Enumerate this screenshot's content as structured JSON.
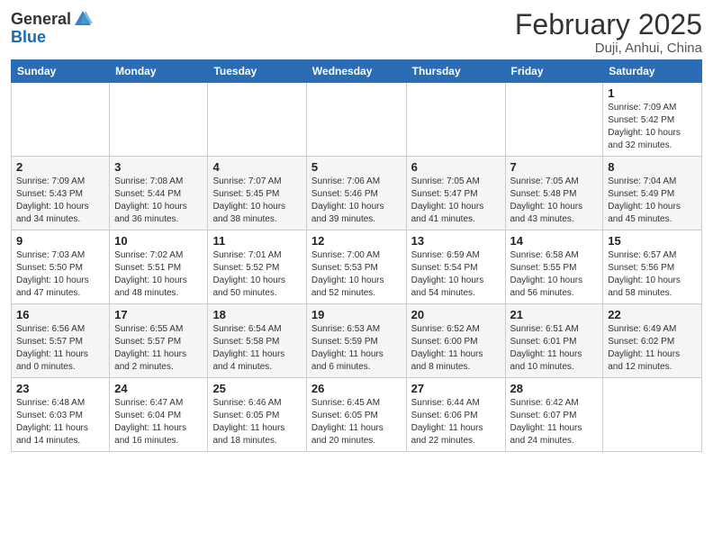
{
  "logo": {
    "general": "General",
    "blue": "Blue"
  },
  "title": "February 2025",
  "location": "Duji, Anhui, China",
  "days_of_week": [
    "Sunday",
    "Monday",
    "Tuesday",
    "Wednesday",
    "Thursday",
    "Friday",
    "Saturday"
  ],
  "weeks": [
    [
      {
        "day": "",
        "info": ""
      },
      {
        "day": "",
        "info": ""
      },
      {
        "day": "",
        "info": ""
      },
      {
        "day": "",
        "info": ""
      },
      {
        "day": "",
        "info": ""
      },
      {
        "day": "",
        "info": ""
      },
      {
        "day": "1",
        "info": "Sunrise: 7:09 AM\nSunset: 5:42 PM\nDaylight: 10 hours\nand 32 minutes."
      }
    ],
    [
      {
        "day": "2",
        "info": "Sunrise: 7:09 AM\nSunset: 5:43 PM\nDaylight: 10 hours\nand 34 minutes."
      },
      {
        "day": "3",
        "info": "Sunrise: 7:08 AM\nSunset: 5:44 PM\nDaylight: 10 hours\nand 36 minutes."
      },
      {
        "day": "4",
        "info": "Sunrise: 7:07 AM\nSunset: 5:45 PM\nDaylight: 10 hours\nand 38 minutes."
      },
      {
        "day": "5",
        "info": "Sunrise: 7:06 AM\nSunset: 5:46 PM\nDaylight: 10 hours\nand 39 minutes."
      },
      {
        "day": "6",
        "info": "Sunrise: 7:05 AM\nSunset: 5:47 PM\nDaylight: 10 hours\nand 41 minutes."
      },
      {
        "day": "7",
        "info": "Sunrise: 7:05 AM\nSunset: 5:48 PM\nDaylight: 10 hours\nand 43 minutes."
      },
      {
        "day": "8",
        "info": "Sunrise: 7:04 AM\nSunset: 5:49 PM\nDaylight: 10 hours\nand 45 minutes."
      }
    ],
    [
      {
        "day": "9",
        "info": "Sunrise: 7:03 AM\nSunset: 5:50 PM\nDaylight: 10 hours\nand 47 minutes."
      },
      {
        "day": "10",
        "info": "Sunrise: 7:02 AM\nSunset: 5:51 PM\nDaylight: 10 hours\nand 48 minutes."
      },
      {
        "day": "11",
        "info": "Sunrise: 7:01 AM\nSunset: 5:52 PM\nDaylight: 10 hours\nand 50 minutes."
      },
      {
        "day": "12",
        "info": "Sunrise: 7:00 AM\nSunset: 5:53 PM\nDaylight: 10 hours\nand 52 minutes."
      },
      {
        "day": "13",
        "info": "Sunrise: 6:59 AM\nSunset: 5:54 PM\nDaylight: 10 hours\nand 54 minutes."
      },
      {
        "day": "14",
        "info": "Sunrise: 6:58 AM\nSunset: 5:55 PM\nDaylight: 10 hours\nand 56 minutes."
      },
      {
        "day": "15",
        "info": "Sunrise: 6:57 AM\nSunset: 5:56 PM\nDaylight: 10 hours\nand 58 minutes."
      }
    ],
    [
      {
        "day": "16",
        "info": "Sunrise: 6:56 AM\nSunset: 5:57 PM\nDaylight: 11 hours\nand 0 minutes."
      },
      {
        "day": "17",
        "info": "Sunrise: 6:55 AM\nSunset: 5:57 PM\nDaylight: 11 hours\nand 2 minutes."
      },
      {
        "day": "18",
        "info": "Sunrise: 6:54 AM\nSunset: 5:58 PM\nDaylight: 11 hours\nand 4 minutes."
      },
      {
        "day": "19",
        "info": "Sunrise: 6:53 AM\nSunset: 5:59 PM\nDaylight: 11 hours\nand 6 minutes."
      },
      {
        "day": "20",
        "info": "Sunrise: 6:52 AM\nSunset: 6:00 PM\nDaylight: 11 hours\nand 8 minutes."
      },
      {
        "day": "21",
        "info": "Sunrise: 6:51 AM\nSunset: 6:01 PM\nDaylight: 11 hours\nand 10 minutes."
      },
      {
        "day": "22",
        "info": "Sunrise: 6:49 AM\nSunset: 6:02 PM\nDaylight: 11 hours\nand 12 minutes."
      }
    ],
    [
      {
        "day": "23",
        "info": "Sunrise: 6:48 AM\nSunset: 6:03 PM\nDaylight: 11 hours\nand 14 minutes."
      },
      {
        "day": "24",
        "info": "Sunrise: 6:47 AM\nSunset: 6:04 PM\nDaylight: 11 hours\nand 16 minutes."
      },
      {
        "day": "25",
        "info": "Sunrise: 6:46 AM\nSunset: 6:05 PM\nDaylight: 11 hours\nand 18 minutes."
      },
      {
        "day": "26",
        "info": "Sunrise: 6:45 AM\nSunset: 6:05 PM\nDaylight: 11 hours\nand 20 minutes."
      },
      {
        "day": "27",
        "info": "Sunrise: 6:44 AM\nSunset: 6:06 PM\nDaylight: 11 hours\nand 22 minutes."
      },
      {
        "day": "28",
        "info": "Sunrise: 6:42 AM\nSunset: 6:07 PM\nDaylight: 11 hours\nand 24 minutes."
      },
      {
        "day": "",
        "info": ""
      }
    ]
  ]
}
